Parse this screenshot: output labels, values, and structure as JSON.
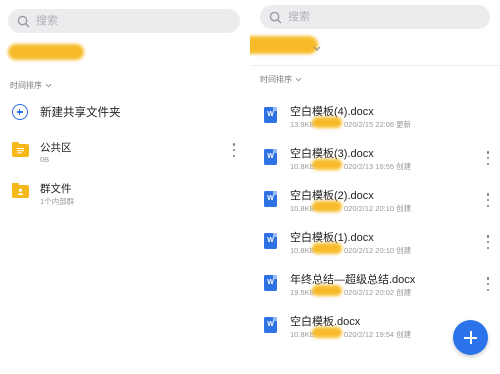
{
  "left_panel": {
    "search_placeholder": "搜索",
    "sort_label": "时间排序",
    "create_shared_folder_label": "新建共享文件夹",
    "folders": [
      {
        "name": "公共区",
        "meta": "0B",
        "icon": "folder-icon"
      },
      {
        "name": "群文件",
        "meta": "1个内部群",
        "icon": "folder-people-icon"
      }
    ]
  },
  "right_panel": {
    "search_placeholder": "搜索",
    "sort_label": "时间排序",
    "files": [
      {
        "name": "空白模板(4).docx",
        "size": "13.9KB",
        "date": "020/2/15 22:06",
        "action": "更新"
      },
      {
        "name": "空白模板(3).docx",
        "size": "10.8KB",
        "date": "020/2/13 16:55",
        "action": "创建"
      },
      {
        "name": "空白模板(2).docx",
        "size": "10.8KB",
        "date": "020/2/12 20:10",
        "action": "创建"
      },
      {
        "name": "空白模板(1).docx",
        "size": "10.8KB",
        "date": "020/2/12 20:10",
        "action": "创建"
      },
      {
        "name": "年终总结—超级总结.docx",
        "size": "19.5KB",
        "date": "020/2/12 20:02",
        "action": "创建"
      },
      {
        "name": "空白模板.docx",
        "size": "10.8KB",
        "date": "020/2/12 19:54",
        "action": "创建"
      }
    ],
    "file_icon_letter": "W"
  },
  "colors": {
    "accent": "#2a73ea",
    "folder": "#f5b818",
    "redaction": "#f7b81e"
  }
}
